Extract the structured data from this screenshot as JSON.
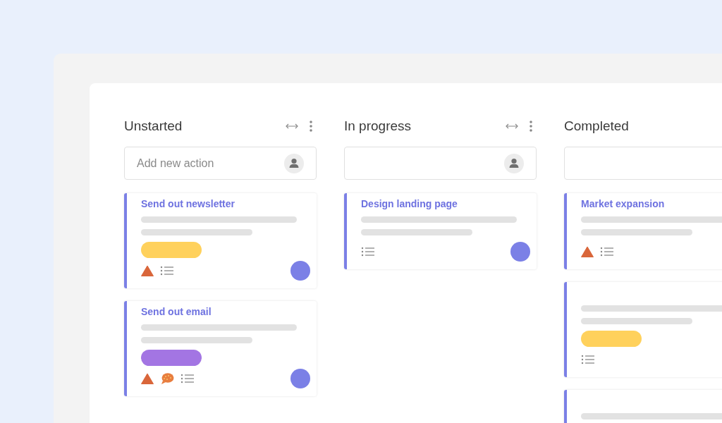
{
  "columns": [
    {
      "title": "Unstarted",
      "header_icons": [
        {
          "kind": "resize"
        },
        {
          "kind": "more"
        }
      ],
      "field_icons": [
        {
          "kind": "user"
        }
      ],
      "placeholder": "Add new action",
      "cards": [
        {
          "kind": "task",
          "title": "Send out newsletter",
          "tag": {
            "color": "#ffd15c"
          },
          "icons": [
            {
              "kind": "warning"
            },
            {
              "kind": "checklist"
            }
          ],
          "avatar": true
        },
        {
          "kind": "task",
          "title": "Send out email",
          "tag": {
            "color": "#a375e3"
          },
          "icons": [
            {
              "kind": "warning"
            },
            {
              "kind": "comment"
            },
            {
              "kind": "checklist"
            }
          ],
          "avatar": true
        }
      ]
    },
    {
      "title": "In progress",
      "header_icons": [
        {
          "kind": "resize"
        },
        {
          "kind": "more"
        }
      ],
      "field_icons": [
        {
          "kind": "user"
        }
      ],
      "cards": [
        {
          "kind": "task",
          "title": "Design landing page",
          "icons": [
            {
              "kind": "checklist"
            }
          ],
          "avatar": true
        }
      ]
    },
    {
      "title": "Completed",
      "cards": [
        {
          "kind": "task",
          "title": "Market expansion",
          "icons": [
            {
              "kind": "warning"
            },
            {
              "kind": "checklist"
            }
          ]
        },
        {
          "kind": "task",
          "tag": {
            "color": "#ffd15c"
          },
          "icons": [
            {
              "kind": "checklist"
            }
          ]
        },
        {
          "kind": "task",
          "cut_off": true
        }
      ]
    }
  ]
}
